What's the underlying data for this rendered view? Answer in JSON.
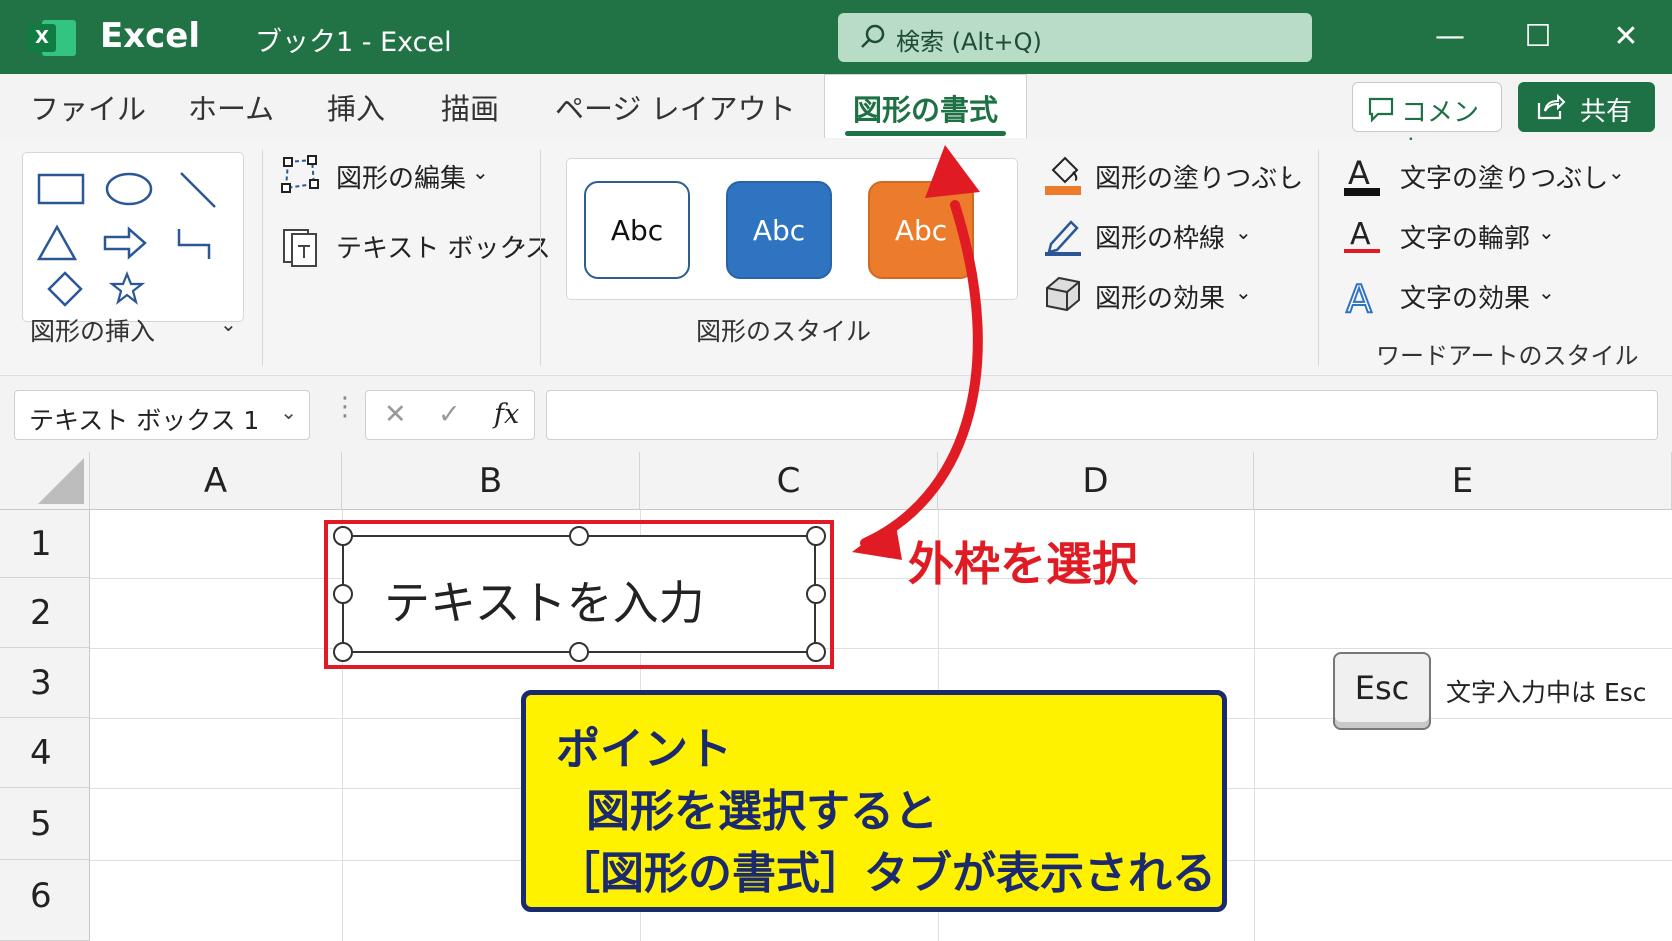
{
  "titlebar": {
    "logo_letter": "X",
    "app_name": "Excel",
    "doc_title": "ブック1  -  Excel",
    "search_placeholder": "検索 (Alt+Q)",
    "minimize": "—",
    "maximize": "☐",
    "close": "✕"
  },
  "tabs": [
    {
      "label": "ファイル"
    },
    {
      "label": "ホーム"
    },
    {
      "label": "挿入"
    },
    {
      "label": "描画"
    },
    {
      "label": "ページ レイアウト"
    },
    {
      "label": "図形の書式",
      "active": true
    }
  ],
  "actions": {
    "comment": "コメント",
    "share": "共有"
  },
  "ribbon": {
    "insert_shapes_label": "図形の挿入",
    "edit_shape": "図形の編集",
    "text_box": "テキスト ボックス",
    "style_label": "図形のスタイル",
    "style_samples": [
      "Abc",
      "Abc",
      "Abc"
    ],
    "shape_fill": "図形の塗りつぶし",
    "shape_outline": "図形の枠線",
    "shape_effects": "図形の効果",
    "text_fill": "文字の塗りつぶし",
    "text_outline": "文字の輪郭",
    "text_effects": "文字の効果",
    "wordart_label": "ワードアートのスタイル",
    "colors": {
      "accent_green": "#217346",
      "blue": "#2f74c0",
      "orange": "#ec7c2c",
      "red": "#e01b24"
    }
  },
  "formula_bar": {
    "name_box": "テキスト ボックス 1",
    "cancel": "✕",
    "enter": "✓",
    "fx": "fx",
    "value": ""
  },
  "grid": {
    "columns": [
      "A",
      "B",
      "C",
      "D",
      "E"
    ],
    "rows": [
      "1",
      "2",
      "3",
      "4",
      "5",
      "6"
    ]
  },
  "textbox_text": "テキストを入力",
  "annotation": "外枠を選択",
  "point": {
    "title": "ポイント",
    "line1": "図形を選択すると",
    "line2": "［図形の書式］タブが表示される"
  },
  "esc": {
    "key": "Esc",
    "note": "文字入力中は Esc"
  }
}
